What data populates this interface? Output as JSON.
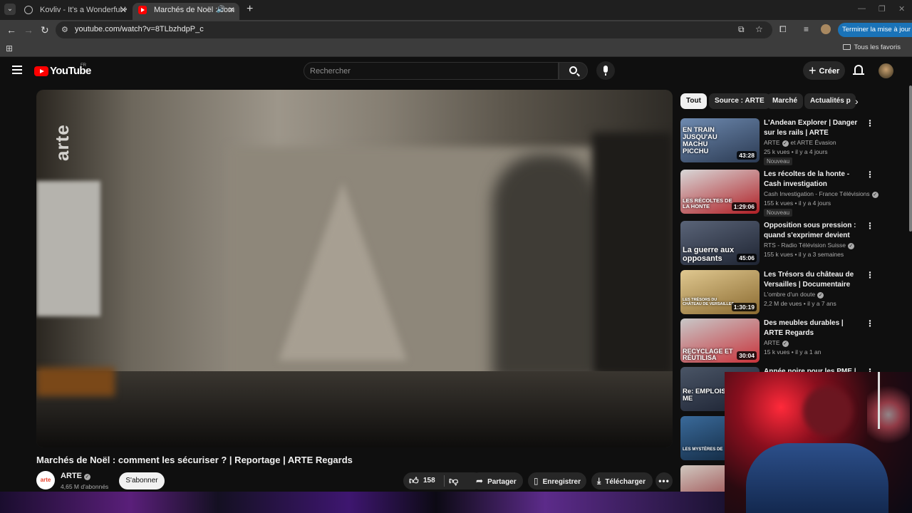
{
  "browser": {
    "tabs": [
      {
        "title": "Kovliv - It's a Wonderful Knife (",
        "active": false
      },
      {
        "title": "Marchés de Noël : commen",
        "active": true
      }
    ],
    "url": "youtube.com/watch?v=8TLbzhdpP_c",
    "update_button": "Terminer la mise à jour",
    "all_bookmarks": "Tous les favoris"
  },
  "masthead": {
    "logo_text": "YouTube",
    "country": "FR",
    "search_placeholder": "Rechercher",
    "create_label": "Créer"
  },
  "player": {
    "watermark": "arte"
  },
  "video": {
    "title": "Marchés de Noël : comment les sécuriser ? | Reportage | ARTE Regards",
    "channel": "ARTE",
    "channel_avatar_text": "arte",
    "subscribers": "4,65 M d'abonnés",
    "subscribe_label": "S'abonner",
    "likes": "158",
    "share_label": "Partager",
    "save_label": "Enregistrer",
    "download_label": "Télécharger"
  },
  "chips": [
    "Tout",
    "Source : ARTE",
    "Marché",
    "Actualités p"
  ],
  "recommendations": [
    {
      "title": "L'Andean Explorer | Danger sur les rails | ARTE",
      "channel": "ARTE",
      "channel_extra": "et ARTE Évasion",
      "verified": true,
      "views": "25 k vues",
      "age": "il y a 4 jours",
      "duration": "43:28",
      "badge": "Nouveau",
      "thumb_text": "EN TRAIN JUSQU'AU MACHU PICCHU",
      "thumb_colors": [
        "#6e8ab0",
        "#2b3a52"
      ]
    },
    {
      "title": "Les récoltes de la honte - Cash investigation",
      "channel": "Cash Investigation - France Télévisions",
      "channel_extra": "",
      "verified": true,
      "views": "155 k vues",
      "age": "il y a 4 jours",
      "duration": "1:29:06",
      "badge": "Nouveau",
      "thumb_text": "LES RÉCOLTES DE LA HONTE",
      "thumb_colors": [
        "#d8d8d8",
        "#b01e24"
      ]
    },
    {
      "title": "Opposition sous pression : quand s'exprimer devient risqu...",
      "channel": "RTS - Radio Télévision Suisse",
      "channel_extra": "",
      "verified": true,
      "views": "155 k vues",
      "age": "il y a 3 semaines",
      "duration": "45:06",
      "badge": "",
      "thumb_text": "La guerre aux opposants",
      "thumb_colors": [
        "#5a6478",
        "#1e2432"
      ]
    },
    {
      "title": "Les Trésors du château de Versailles | Documentaire",
      "channel": "L'ombre d'un doute",
      "channel_extra": "",
      "verified": true,
      "views": "2,2 M de vues",
      "age": "il y a 7 ans",
      "duration": "1:30:19",
      "badge": "",
      "thumb_text": "LES TRÉSORS DU CHÂTEAU DE VERSAILLES",
      "thumb_colors": [
        "#e0c890",
        "#8a6a30"
      ]
    },
    {
      "title": "Des meubles durables | ARTE Regards",
      "channel": "ARTE",
      "channel_extra": "",
      "verified": true,
      "views": "15 k vues",
      "age": "il y a 1 an",
      "duration": "30:04",
      "badge": "",
      "thumb_text": "RECYCLAGE ET RÉUTILISA",
      "thumb_colors": [
        "#c8c8c8",
        "#c8323a"
      ]
    },
    {
      "title": "Année noire pour les PME |",
      "channel": "",
      "channel_extra": "",
      "verified": false,
      "views": "",
      "age": "",
      "duration": "",
      "badge": "",
      "thumb_text": "Re: EMPLOIS ME",
      "thumb_colors": [
        "#4a5566",
        "#1a2030"
      ]
    },
    {
      "title": "",
      "channel": "",
      "channel_extra": "",
      "verified": false,
      "views": "",
      "age": "",
      "duration": "",
      "badge": "",
      "thumb_text": "LES MYSTÈRES DE",
      "thumb_colors": [
        "#3a6a9a",
        "#0e2238"
      ]
    },
    {
      "title": "",
      "channel": "",
      "channel_extra": "",
      "verified": false,
      "views": "",
      "age": "",
      "duration": "",
      "badge": "",
      "thumb_text": "",
      "thumb_colors": [
        "#d0c8c0",
        "#8a1e24"
      ]
    }
  ]
}
